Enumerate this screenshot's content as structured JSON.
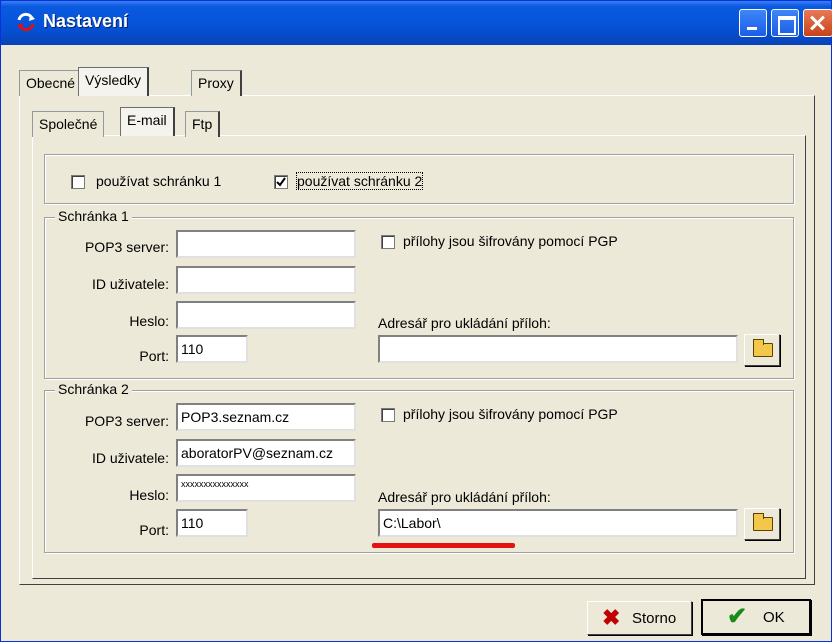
{
  "window": {
    "title": "Nastavení"
  },
  "tabs_main": [
    "Obecné",
    "Výsledky",
    "Proxy"
  ],
  "tabs_sub": [
    "Společné",
    "E-mail",
    "Ftp"
  ],
  "mailboxes": {
    "use_mailbox1": {
      "label": "používat schránku 1",
      "checked": false
    },
    "use_mailbox2": {
      "label": "používat schránku 2",
      "checked": true
    }
  },
  "mailbox1": {
    "legend": "Schránka 1",
    "pop3_label": "POP3 server:",
    "pop3_value": "",
    "user_label": "ID uživatele:",
    "user_value": "",
    "password_label": "Heslo:",
    "password_value": "",
    "port_label": "Port:",
    "port_value": "110",
    "pgp_label": "přílohy jsou šifrovány pomocí PGP",
    "pgp_checked": false,
    "attach_dir_label": "Adresář pro ukládání příloh:",
    "attach_dir_value": ""
  },
  "mailbox2": {
    "legend": "Schránka 2",
    "pop3_label": "POP3 server:",
    "pop3_value": "POP3.seznam.cz",
    "user_label": "ID uživatele:",
    "user_value": "aboratorPV@seznam.cz",
    "password_label": "Heslo:",
    "password_value": "xxxxxxxxxxxxxxx",
    "port_label": "Port:",
    "port_value": "110",
    "pgp_label": "přílohy jsou šifrovány pomocí PGP",
    "pgp_checked": false,
    "attach_dir_label": "Adresář pro ukládání příloh:",
    "attach_dir_value": "C:\\Labor\\"
  },
  "buttons": {
    "cancel": "Storno",
    "ok": "OK"
  },
  "colors": {
    "titlebar": "#0552d6",
    "dialog_bg": "#ece9d8",
    "highlight_underline": "#e51212",
    "cancel_icon": "#c00000",
    "ok_icon": "#1a8a1a"
  },
  "icons": {
    "app": "refresh-arrows-icon",
    "browse": "open-folder-icon",
    "cancel": "x-mark-icon",
    "ok": "check-mark-icon"
  }
}
